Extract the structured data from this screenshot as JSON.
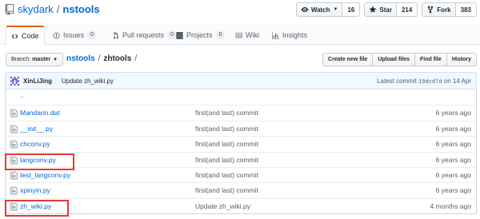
{
  "repo": {
    "owner": "skydark",
    "separator": "/",
    "name": "nstools"
  },
  "actions": {
    "watch": {
      "label": "Watch",
      "count": "16"
    },
    "star": {
      "label": "Star",
      "count": "214"
    },
    "fork": {
      "label": "Fork",
      "count": "383"
    }
  },
  "tabs": [
    {
      "label": "Code",
      "icon": "code-icon",
      "counter": ""
    },
    {
      "label": "Issues",
      "icon": "issue-icon",
      "counter": "0"
    },
    {
      "label": "Pull requests",
      "icon": "pull-request-icon",
      "counter": "0"
    },
    {
      "label": "Projects",
      "icon": "project-icon",
      "counter": "0"
    },
    {
      "label": "Wiki",
      "icon": "book-icon",
      "counter": ""
    },
    {
      "label": "Insights",
      "icon": "graph-icon",
      "counter": ""
    }
  ],
  "nav": {
    "branch_prefix": "Branch:",
    "branch": "master",
    "breadcrumb_repo": "nstools",
    "breadcrumb_sep": "/",
    "breadcrumb_dir": "zhtools",
    "breadcrumb_trail": "/",
    "buttons": [
      "Create new file",
      "Upload files",
      "Find file",
      "History"
    ]
  },
  "commit": {
    "author": "XinLiJing",
    "message": "Update zh_wiki.py",
    "latest_label": "Latest commit",
    "sha": "19dcd7d",
    "date": "on 14 Apr"
  },
  "files": [
    {
      "name": "..",
      "message": "",
      "age": ""
    },
    {
      "name": "Mandarin.dat",
      "message": "first(and last) commit",
      "age": "6 years ago"
    },
    {
      "name": "__init__.py",
      "message": "first(and last) commit",
      "age": "6 years ago"
    },
    {
      "name": "chconv.py",
      "message": "first(and last) commit",
      "age": "6 years ago"
    },
    {
      "name": "langconv.py",
      "message": "first(and last) commit",
      "age": "6 years ago"
    },
    {
      "name": "test_langconv.py",
      "message": "first(and last) commit",
      "age": "6 years ago"
    },
    {
      "name": "xpinyin.py",
      "message": "first(and last) commit",
      "age": "6 years ago"
    },
    {
      "name": "zh_wiki.py",
      "message": "Update zh_wiki.py",
      "age": "4 months ago"
    }
  ],
  "colors": {
    "link": "#0366d6",
    "highlight": "#e53935",
    "tab_accent": "#e36209",
    "commit_bg": "#f1f8ff"
  }
}
